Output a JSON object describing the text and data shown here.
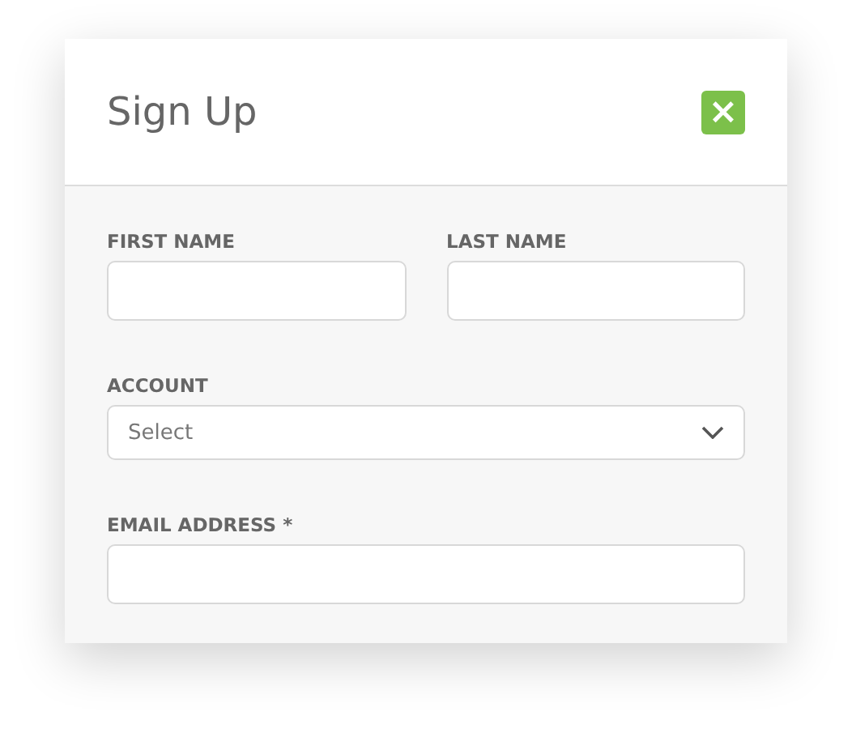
{
  "dialog": {
    "title": "Sign Up",
    "close_button": {
      "label": "×"
    }
  },
  "form_rows": [
    {
      "fields": [
        {
          "kind": "text",
          "label": "FIRST NAME"
        },
        {
          "kind": "text",
          "label": "LAST NAME"
        }
      ]
    },
    {
      "fields": [
        {
          "kind": "select",
          "label": "ACCOUNT",
          "value": "Select"
        }
      ]
    },
    {
      "fields": [
        {
          "kind": "text",
          "label": "EMAIL ADDRESS *"
        }
      ]
    }
  ]
}
